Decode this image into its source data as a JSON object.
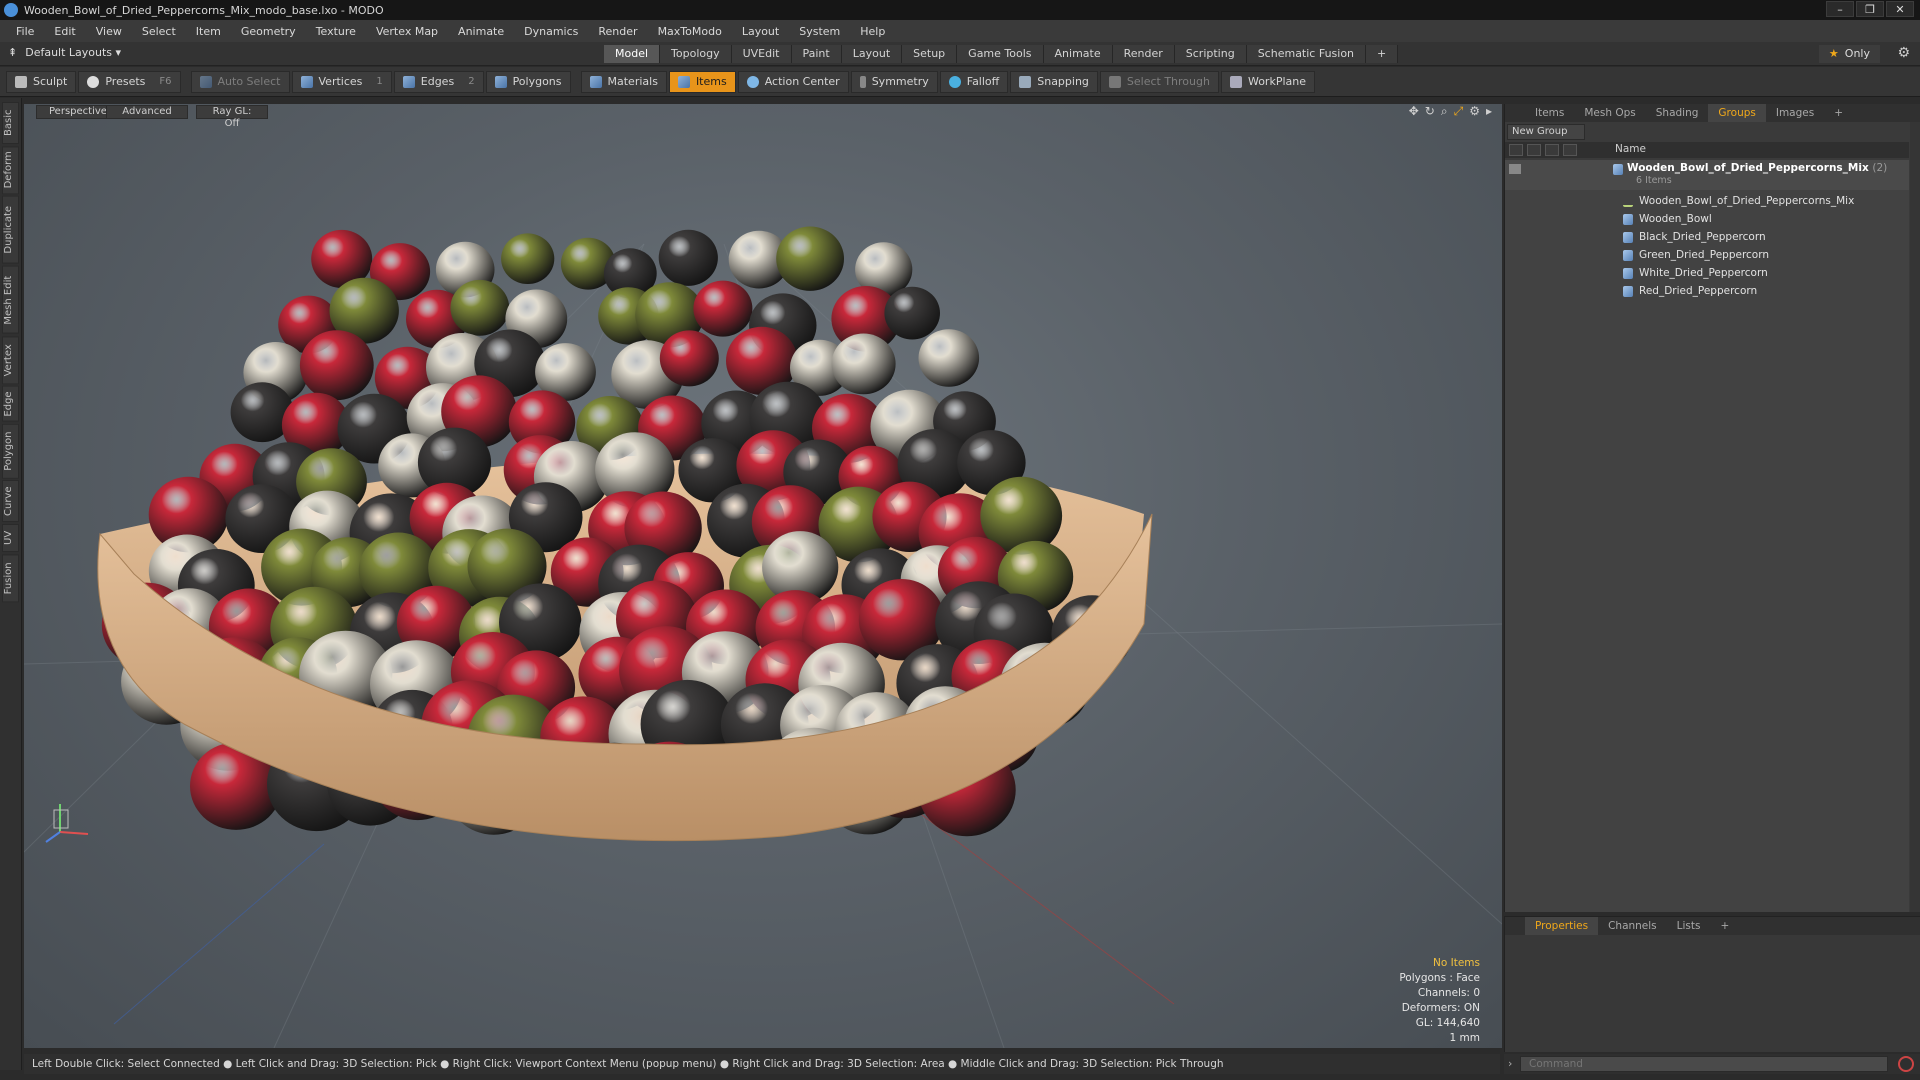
{
  "window": {
    "title": "Wooden_Bowl_of_Dried_Peppercorns_Mix_modo_base.lxo - MODO",
    "min": "–",
    "max": "❐",
    "close": "✕"
  },
  "menu": [
    "File",
    "Edit",
    "View",
    "Select",
    "Item",
    "Geometry",
    "Texture",
    "Vertex Map",
    "Animate",
    "Dynamics",
    "Render",
    "MaxToModo",
    "Layout",
    "System",
    "Help"
  ],
  "layout_bar": {
    "dropdown": "Default Layouts ▾",
    "tabs": [
      "Model",
      "Topology",
      "UVEdit",
      "Paint",
      "Layout",
      "Setup",
      "Game Tools",
      "Animate",
      "Render",
      "Scripting",
      "Schematic Fusion",
      "+"
    ],
    "active_tab": "Model",
    "only_label": "Only"
  },
  "toolbar": {
    "sculpt": "Sculpt",
    "presets": "Presets",
    "presets_hint": "F6",
    "auto_select": "Auto Select",
    "vertices": "Vertices",
    "vertices_count": "1",
    "edges": "Edges",
    "edges_count": "2",
    "polygons": "Polygons",
    "materials": "Materials",
    "items": "Items",
    "action_center": "Action Center",
    "symmetry": "Symmetry",
    "falloff": "Falloff",
    "snapping": "Snapping",
    "select_through": "Select Through",
    "workplane": "WorkPlane"
  },
  "left_tabs": [
    "Basic",
    "Deform",
    "Duplicate",
    "Mesh Edit",
    "Vertex",
    "Edge",
    "Polygon",
    "Curve",
    "UV",
    "Fusion"
  ],
  "viewport": {
    "view": "Perspective",
    "shading": "Advanced",
    "raygl": "Ray GL: Off",
    "stats": {
      "items": "No Items",
      "polygons": "Polygons : Face",
      "channels": "Channels: 0",
      "deformers": "Deformers: ON",
      "gl": "GL: 144,640",
      "scale": "1 mm"
    },
    "peppercorn_colors": {
      "red": "#c8283a",
      "white": "#e2ddd0",
      "black": "#3e3c3c",
      "green": "#7f8a3a"
    },
    "bowl_color": "#e6c29c"
  },
  "status_bar": "Left Double Click: Select Connected ● Left Click and Drag: 3D Selection: Pick ● Right Click: Viewport Context Menu (popup menu) ● Right Click and Drag: 3D Selection: Area ● Middle Click and Drag: 3D Selection: Pick Through",
  "right_panel": {
    "tabs": [
      "Items",
      "Mesh Ops",
      "Shading",
      "Groups",
      "Images",
      "+"
    ],
    "active_tab": "Groups",
    "new_group": "New Group",
    "column_name": "Name",
    "root": {
      "name": "Wooden_Bowl_of_Dried_Peppercorns_Mix",
      "count": "(2)",
      "sub": "6 Items"
    },
    "items": [
      "Wooden_Bowl_of_Dried_Peppercorns_Mix",
      "Wooden_Bowl",
      "Black_Dried_Peppercorn",
      "Green_Dried_Peppercorn",
      "White_Dried_Peppercorn",
      "Red_Dried_Peppercorn"
    ]
  },
  "properties_panel": {
    "tabs": [
      "Properties",
      "Channels",
      "Lists",
      "+"
    ],
    "active_tab": "Properties"
  },
  "command": {
    "placeholder": "Command"
  },
  "accent": "#e8941a"
}
